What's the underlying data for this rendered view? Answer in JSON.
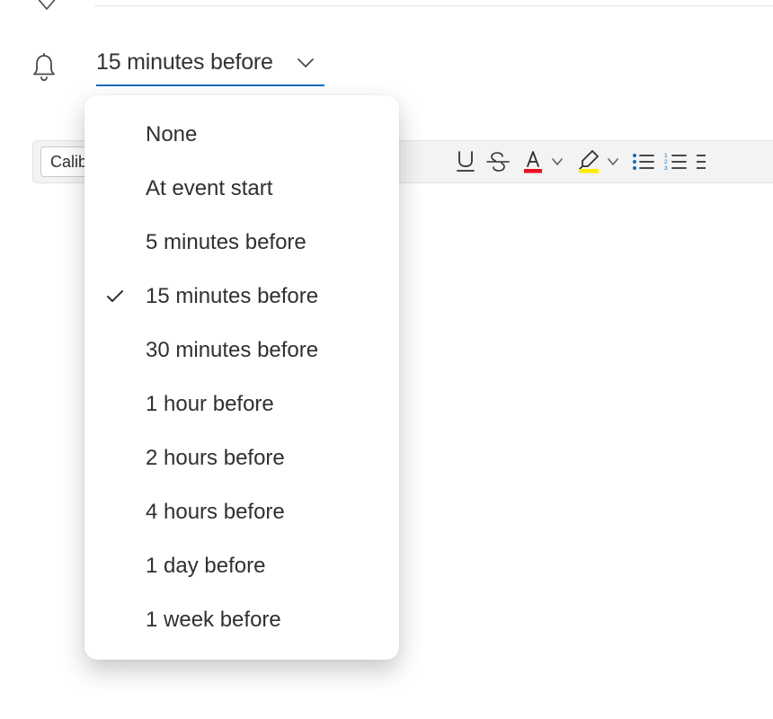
{
  "top": {
    "has_chevron": true
  },
  "reminder": {
    "selected_label": "15 minutes before",
    "options": [
      "None",
      "At event start",
      "5 minutes before",
      "15 minutes before",
      "30 minutes before",
      "1 hour before",
      "2 hours before",
      "4 hours before",
      "1 day before",
      "1 week before"
    ],
    "selected_index": 3
  },
  "toolbar": {
    "font_name": "Calib",
    "underline_color_bar": "#0f6cbd",
    "font_color_swatch": "#e81123",
    "highlight_color_swatch": "#ffeb00"
  }
}
